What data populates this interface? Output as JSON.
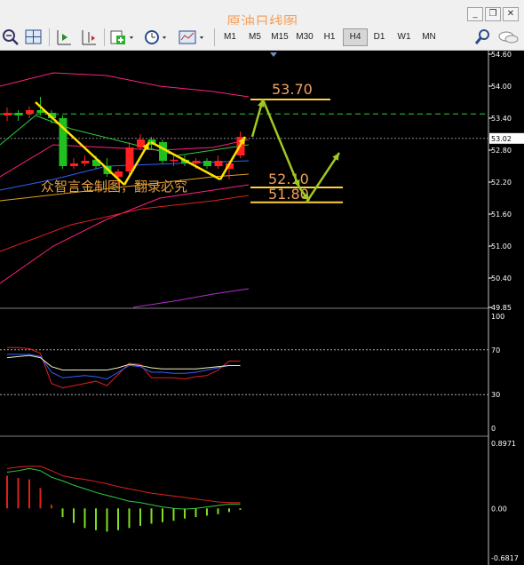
{
  "window": {
    "title": "原油日线图",
    "controls": [
      "_",
      "❐",
      "✕"
    ]
  },
  "toolbar": {
    "timeframes": [
      "M1",
      "M5",
      "M15",
      "M30",
      "H1",
      "H4",
      "D1",
      "W1",
      "MN"
    ],
    "active_timeframe": "H4",
    "icons": [
      "zoom-out-icon",
      "tile-windows-icon",
      "auto-scroll-icon",
      "chart-shift-icon",
      "new-indicator-icon",
      "periodicity-icon",
      "templates-icon",
      "search-icon",
      "chat-icon"
    ]
  },
  "colors": {
    "background": "#000000",
    "bull_candle": "#ff2020",
    "bear_candle": "#20c020",
    "bollinger": "#ff2080",
    "ma_green": "#2ecc40",
    "ma_red": "#e02020",
    "ma_blue": "#3060ff",
    "ma_orange": "#e0a020",
    "arrow_yellow": "#ffe000",
    "arrow_green": "#a0c820",
    "level_line": "#ffd040",
    "level_text": "#f2a15e"
  },
  "chart_data": [
    {
      "type": "candlestick",
      "panel": "price",
      "y_ticks": [
        "54.60",
        "54.00",
        "53.40",
        "52.80",
        "52.20",
        "51.60",
        "51.00",
        "50.40",
        "49.85"
      ],
      "ylim": [
        49.85,
        54.6
      ],
      "current_price": "53.02",
      "levels": [
        {
          "label": "53.70",
          "value": 53.75
        },
        {
          "label": "52.10",
          "value": 52.1
        },
        {
          "label": "51.80",
          "value": 51.82
        }
      ],
      "annotation": "众智言金制图，翻录必究",
      "candles": [
        {
          "o": 53.45,
          "c": 53.5,
          "h": 53.6,
          "l": 53.35
        },
        {
          "o": 53.5,
          "c": 53.45,
          "h": 53.55,
          "l": 53.35
        },
        {
          "o": 53.48,
          "c": 53.55,
          "h": 53.62,
          "l": 53.4
        },
        {
          "o": 53.55,
          "c": 53.5,
          "h": 53.8,
          "l": 53.45
        },
        {
          "o": 53.5,
          "c": 53.4,
          "h": 53.55,
          "l": 53.3
        },
        {
          "o": 53.4,
          "c": 52.5,
          "h": 53.45,
          "l": 52.45
        },
        {
          "o": 52.5,
          "c": 52.55,
          "h": 52.65,
          "l": 52.45
        },
        {
          "o": 52.55,
          "c": 52.6,
          "h": 52.7,
          "l": 52.5
        },
        {
          "o": 52.62,
          "c": 52.5,
          "h": 52.7,
          "l": 52.45
        },
        {
          "o": 52.5,
          "c": 52.35,
          "h": 52.65,
          "l": 52.3
        },
        {
          "o": 52.3,
          "c": 52.4,
          "h": 52.45,
          "l": 52.15
        },
        {
          "o": 52.4,
          "c": 52.85,
          "h": 52.95,
          "l": 52.35
        },
        {
          "o": 52.85,
          "c": 53.0,
          "h": 53.1,
          "l": 52.8
        },
        {
          "o": 53.0,
          "c": 52.9,
          "h": 53.05,
          "l": 52.8
        },
        {
          "o": 52.95,
          "c": 52.6,
          "h": 53.0,
          "l": 52.55
        },
        {
          "o": 52.6,
          "c": 52.62,
          "h": 52.7,
          "l": 52.5
        },
        {
          "o": 52.62,
          "c": 52.55,
          "h": 52.7,
          "l": 52.5
        },
        {
          "o": 52.55,
          "c": 52.6,
          "h": 52.65,
          "l": 52.45
        },
        {
          "o": 52.6,
          "c": 52.5,
          "h": 52.65,
          "l": 52.45
        },
        {
          "o": 52.5,
          "c": 52.6,
          "h": 52.7,
          "l": 52.45
        },
        {
          "o": 52.45,
          "c": 52.55,
          "h": 52.6,
          "l": 52.25
        },
        {
          "o": 52.7,
          "c": 53.05,
          "h": 53.15,
          "l": 52.65
        }
      ]
    },
    {
      "type": "line",
      "panel": "oscillator",
      "y_ticks": [
        "100",
        "70",
        "30",
        "0"
      ],
      "ylim": [
        0,
        100
      ],
      "series": [
        {
          "color": "#e02020",
          "values": [
            72,
            72,
            71,
            67,
            40,
            36,
            38,
            40,
            42,
            38,
            48,
            58,
            57,
            45,
            45,
            45,
            44,
            46,
            47,
            52,
            60,
            60
          ]
        },
        {
          "color": "#3060ff",
          "values": [
            66,
            66,
            66,
            64,
            50,
            45,
            46,
            47,
            46,
            44,
            50,
            56,
            55,
            50,
            50,
            49,
            49,
            50,
            52,
            54,
            56,
            56
          ]
        },
        {
          "color": "#f0f0c0",
          "values": [
            63,
            64,
            65,
            63,
            55,
            52,
            52,
            52,
            52,
            52,
            54,
            57,
            56,
            54,
            53,
            53,
            53,
            53,
            54,
            55,
            56,
            56
          ]
        }
      ]
    },
    {
      "type": "bar",
      "panel": "macd",
      "y_ticks": [
        "0.8971",
        "0.00",
        "-0.6817"
      ],
      "ylim": [
        -0.6817,
        0.8971
      ],
      "histogram": [
        0.45,
        0.42,
        0.4,
        0.28,
        0.05,
        -0.12,
        -0.2,
        -0.27,
        -0.3,
        -0.32,
        -0.3,
        -0.27,
        -0.24,
        -0.21,
        -0.19,
        -0.17,
        -0.14,
        -0.12,
        -0.1,
        -0.08,
        -0.05,
        -0.02
      ],
      "signal": [
        0.55,
        0.57,
        0.58,
        0.58,
        0.52,
        0.45,
        0.42,
        0.4,
        0.37,
        0.34,
        0.3,
        0.27,
        0.24,
        0.21,
        0.19,
        0.17,
        0.15,
        0.13,
        0.11,
        0.09,
        0.08,
        0.08
      ],
      "main": [
        0.5,
        0.52,
        0.55,
        0.52,
        0.43,
        0.38,
        0.32,
        0.27,
        0.22,
        0.18,
        0.14,
        0.1,
        0.08,
        0.05,
        0.02,
        0.0,
        -0.01,
        0.0,
        0.02,
        0.04,
        0.06,
        0.06
      ]
    }
  ]
}
